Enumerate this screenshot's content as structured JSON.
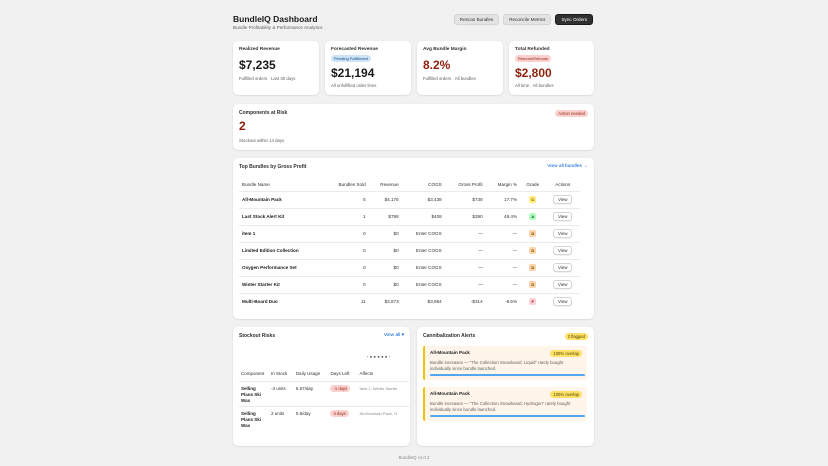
{
  "header": {
    "title": "BundleIQ Dashboard",
    "subtitle": "Bundle Profitability & Performance Analytics",
    "buttons": {
      "rescan": "Rescan Bundles",
      "reconcile": "Reconcile Metrics",
      "sync": "Sync Orders"
    }
  },
  "metrics": [
    {
      "label": "Realized Revenue",
      "value": "$7,235",
      "sub": "Fulfilled orders · Last 30 days"
    },
    {
      "label": "Forecasted Revenue",
      "badge": "Pending Fulfillment",
      "value": "$21,194",
      "sub": "All unfulfilled order lines"
    },
    {
      "label": "Avg Bundle Margin",
      "value": "8.2%",
      "sub": "Fulfilled orders · All bundles"
    },
    {
      "label": "Total Refunded",
      "badge": "Returns/Refunds",
      "value": "$2,800",
      "sub": "All time · All bundles"
    }
  ],
  "components_risk": {
    "label": "Components at Risk",
    "badge": "Action needed",
    "value": "2",
    "sub": "Stockout within 14 days"
  },
  "top_bundles": {
    "title": "Top Bundles by Gross Profit",
    "view_all": "View all bundles →",
    "columns": [
      "Bundle Name",
      "Bundles Sold",
      "Revenue",
      "COGS",
      "Gross Profit",
      "Margin %",
      "Grade",
      "Actions"
    ],
    "action_label": "View",
    "rows": [
      {
        "name": "All-Mountain Pack",
        "sold": "5",
        "revenue": "$4,176",
        "cogs": "$3,438",
        "profit": "$738",
        "margin": "17.7%",
        "grade": "C",
        "grade_class": "g-c",
        "cogs_class": "",
        "margin_class": "pos"
      },
      {
        "name": "Last Stock Alert Kit",
        "sold": "1",
        "revenue": "$798",
        "cogs": "$408",
        "profit": "$390",
        "margin": "48.4%",
        "grade": "A",
        "grade_class": "g-a",
        "cogs_class": "",
        "margin_class": "pos"
      },
      {
        "name": "item 1",
        "sold": "0",
        "revenue": "$0",
        "cogs": "Enter COGS",
        "profit": "—",
        "margin": "—",
        "grade": "D",
        "grade_class": "g-d",
        "cogs_class": "muted",
        "margin_class": ""
      },
      {
        "name": "Limited Edition Collection",
        "sold": "0",
        "revenue": "$0",
        "cogs": "Enter COGS",
        "profit": "—",
        "margin": "—",
        "grade": "D",
        "grade_class": "g-d",
        "cogs_class": "muted",
        "margin_class": ""
      },
      {
        "name": "Oxygen Performance Set",
        "sold": "0",
        "revenue": "$0",
        "cogs": "Enter COGS",
        "profit": "—",
        "margin": "—",
        "grade": "D",
        "grade_class": "g-d",
        "cogs_class": "muted",
        "margin_class": ""
      },
      {
        "name": "Winter Starter Kit",
        "sold": "0",
        "revenue": "$0",
        "cogs": "Enter COGS",
        "profit": "—",
        "margin": "—",
        "grade": "D",
        "grade_class": "g-d",
        "cogs_class": "muted",
        "margin_class": ""
      },
      {
        "name": "Multi-Board Duo",
        "sold": "11",
        "revenue": "$3,673",
        "cogs": "$3,984",
        "profit": "-$314",
        "margin": "-8.5%",
        "grade": "F",
        "grade_class": "g-f",
        "cogs_class": "",
        "margin_class": "neg"
      }
    ]
  },
  "stockout": {
    "title": "Stockout Risks",
    "view_all": "View all ▾",
    "pager": "‹  ● ● ● ● ●  ›",
    "columns": [
      "Component",
      "In Stock",
      "Daily Usage",
      "Days Left",
      "Affects"
    ],
    "rows": [
      {
        "component": "Selling Plans Ski Wax",
        "stock": "-3 units",
        "usage": "5.67/day",
        "days": "-1 days",
        "affects": "Item 1, Winter Starter"
      },
      {
        "component": "Selling Plans Ski Wax",
        "stock": "2 units",
        "usage": "0.5/day",
        "days": "4 days",
        "affects": "All-Mountain Pack, O"
      }
    ]
  },
  "cannibal": {
    "title": "Cannibalization Alerts",
    "badge": "2 flagged",
    "alerts": [
      {
        "title": "All-Mountain Pack",
        "overlap": "100% overlap",
        "desc": "Bundle increases — \"The Collection Snowboard: Liquid\" rarely bought individually since bundle launched.",
        "fill": 1.0
      },
      {
        "title": "All-Mountain Pack",
        "overlap": "100% overlap",
        "desc": "Bundle increases — \"The Collection Snowboard: Hydrogen\" rarely bought individually since bundle launched.",
        "fill": 1.0
      }
    ]
  },
  "footer": "BundleIQ v1.0.2"
}
